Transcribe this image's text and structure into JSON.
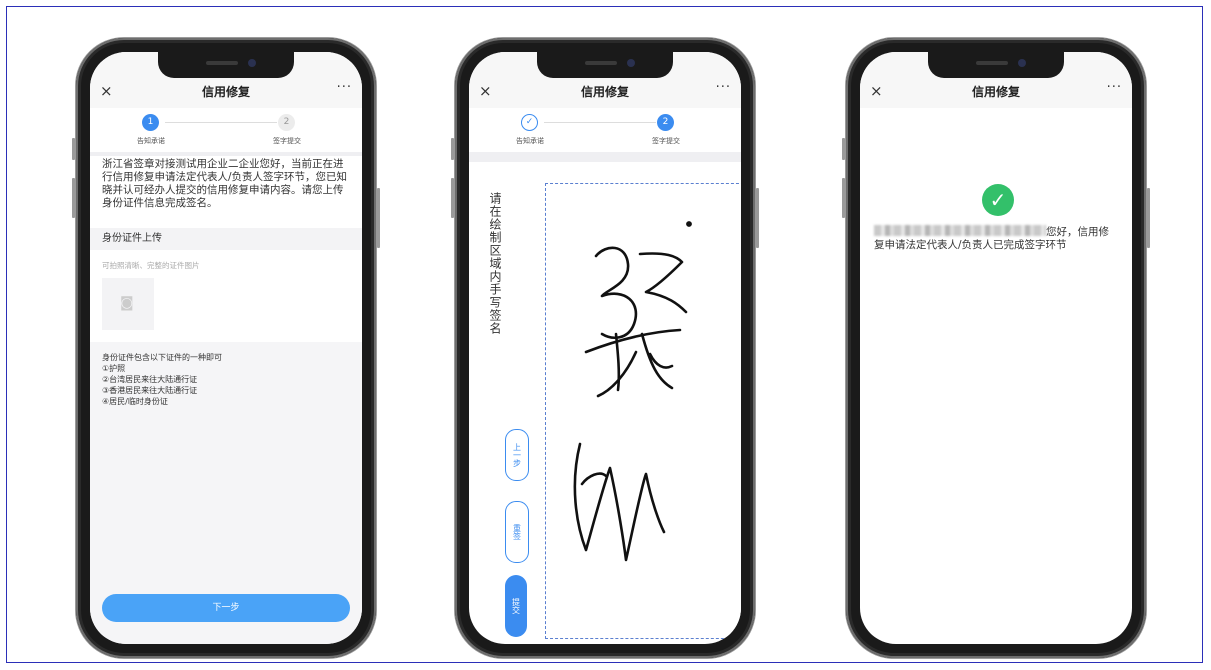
{
  "nav": {
    "close": "×",
    "title": "信用修复",
    "more": "···"
  },
  "steps": {
    "step1_num": "1",
    "step1_label": "告知承诺",
    "step2_num": "2",
    "step2_label": "签字提交",
    "done_mark": "✓"
  },
  "phone1": {
    "intro": "浙江省签章对接测试用企业二企业您好，当前正在进行信用修复申请法定代表人/负责人签字环节，您已知晓并认可经办人提交的信用修复申请内容。请您上传身份证件信息完成签名。",
    "section_title": "身份证件上传",
    "upload_hint": "可拍照清晰、完整的证件图片",
    "notes": [
      "身份证件包含以下证件的一种即可",
      "①护照",
      "②台湾居民来往大陆通行证",
      "③香港居民来往大陆通行证",
      "④居民/临时身份证"
    ],
    "next_button": "下一步"
  },
  "phone2": {
    "instruction": "请在绘制区域内手写签名",
    "prev_button": "上一步",
    "reset_button": "重签",
    "submit_button": "提交"
  },
  "phone3": {
    "message_suffix": "您好，信用修复申请法定代表人/负责人已完成签字环节"
  },
  "colors": {
    "accent": "#3b8cf0",
    "success": "#33c06a",
    "frame_border": "#2b2fb8"
  },
  "icons": {
    "close": "close-icon",
    "more": "more-icon",
    "camera": "camera-icon",
    "check": "check-circle-icon"
  }
}
